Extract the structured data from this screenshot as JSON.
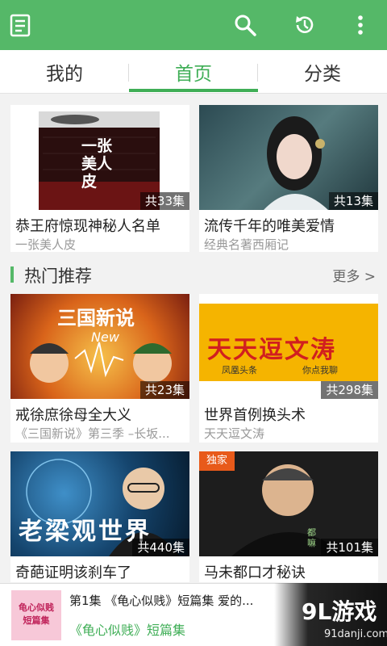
{
  "colors": {
    "accent": "#55b868",
    "active_tab": "#3fae56"
  },
  "toolbar": {
    "icons": [
      "list-icon",
      "search-icon",
      "history-icon",
      "more-icon"
    ]
  },
  "tabs": [
    {
      "label": "我的"
    },
    {
      "label": "首页"
    },
    {
      "label": "分类"
    }
  ],
  "top_cards": [
    {
      "title": "恭王府惊现神秘人名单",
      "subtitle": "一张美人皮",
      "count": "共33集",
      "art_text": "一张美人皮"
    },
    {
      "title": "流传千年的唯美爱情",
      "subtitle": "经典名著西厢记",
      "count": "共13集"
    }
  ],
  "section": {
    "title": "热门推荐",
    "more": "更多"
  },
  "hot_cards": [
    {
      "title": "戒徐庶徐母全大义",
      "subtitle": "《三国新说》第三季 –长坂...",
      "count": "共23集",
      "art_text": "三国新说",
      "art_text2": "New"
    },
    {
      "title": "世界首例换头术",
      "subtitle": "天天逗文涛",
      "count": "共298集",
      "art_text": "天天逗文涛",
      "art_text2": "凤凰头条",
      "art_text3": "你点我聊"
    },
    {
      "title": "奇葩证明该刹车了",
      "subtitle": "",
      "count": "共440集",
      "art_text": "老梁观世界"
    },
    {
      "title": "马未都口才秘诀",
      "subtitle": "",
      "count": "共101集",
      "badge": "独家",
      "art_text": "都嘛"
    }
  ],
  "player": {
    "line1": "第1集 《龟心似贱》短篇集 爱的...",
    "line2": "《龟心似贱》短篇集",
    "cover_text": "龟心似贱 短篇集"
  },
  "watermark": {
    "big": "9L游戏",
    "small": "91danji.com"
  }
}
